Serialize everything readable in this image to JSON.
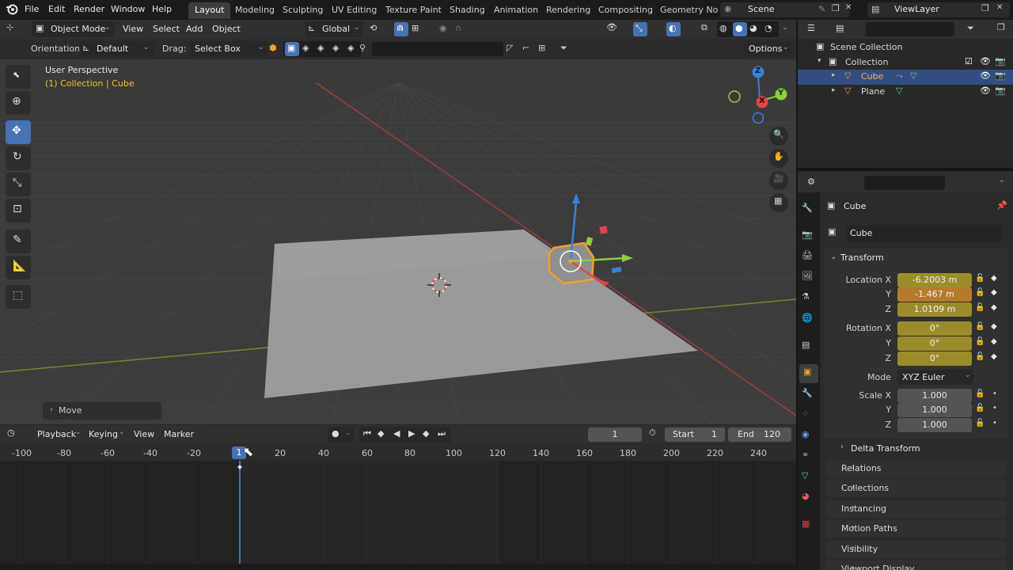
{
  "menu": [
    "File",
    "Edit",
    "Render",
    "Window",
    "Help"
  ],
  "workspaces": [
    "Layout",
    "Modeling",
    "Sculpting",
    "UV Editing",
    "Texture Paint",
    "Shading",
    "Animation",
    "Rendering",
    "Compositing",
    "Geometry Noc"
  ],
  "scene": "Scene",
  "view_layer": "ViewLayer",
  "viewport_header": {
    "mode": "Object Mode",
    "menus": [
      "View",
      "Select",
      "Add",
      "Object"
    ],
    "transform_space": "Global"
  },
  "tool_settings": {
    "orientation_label": "Orientation:",
    "orientation_value": "Default",
    "drag_label": "Drag:",
    "drag_value": "Select Box",
    "options": "Options"
  },
  "viewport_info": {
    "perspective": "User Perspective",
    "collection": "(1) Collection | Cube"
  },
  "operator_panel": "Move",
  "gizmo_axes": {
    "z": "Z",
    "y": "Y",
    "x": "X"
  },
  "timeline": {
    "menus": [
      "Playback",
      "Keying",
      "View",
      "Marker"
    ],
    "current_frame": "1",
    "start_label": "Start",
    "start": "1",
    "end_label": "End",
    "end": "120",
    "ticks": [
      "-100",
      "-80",
      "-60",
      "-40",
      "-20",
      "20",
      "40",
      "60",
      "80",
      "100",
      "120",
      "140",
      "160",
      "180",
      "200",
      "220",
      "240"
    ],
    "playhead": "1"
  },
  "outliner": {
    "scene_collection": "Scene Collection",
    "collection": "Collection",
    "items": [
      "Cube",
      "Plane"
    ]
  },
  "properties": {
    "object_name": "Cube",
    "datablock": "Cube",
    "transform_title": "Transform",
    "location": {
      "label": "Location X",
      "x": "-6.2003 m",
      "y": "-1.467 m",
      "z": "1.0109 m"
    },
    "rotation": {
      "label": "Rotation X",
      "x": "0°",
      "y": "0°",
      "z": "0°"
    },
    "axis_labels": {
      "y": "Y",
      "z": "Z"
    },
    "mode_label": "Mode",
    "mode_value": "XYZ Euler",
    "scale": {
      "label": "Scale X",
      "x": "1.000",
      "y": "1.000",
      "z": "1.000"
    },
    "delta_transform": "Delta Transform",
    "panels": [
      "Relations",
      "Collections",
      "Instancing",
      "Motion Paths",
      "Visibility",
      "Viewport Display"
    ]
  },
  "colors": {
    "accent": "#4772b3",
    "selected_row": "#334d80",
    "keyed_field": "#9b8c2b",
    "changed_field": "#b57b2b",
    "axis_x": "#e04646",
    "axis_y": "#8ccf3c",
    "axis_z": "#3b82d8",
    "selection_outline": "#f0a030"
  }
}
